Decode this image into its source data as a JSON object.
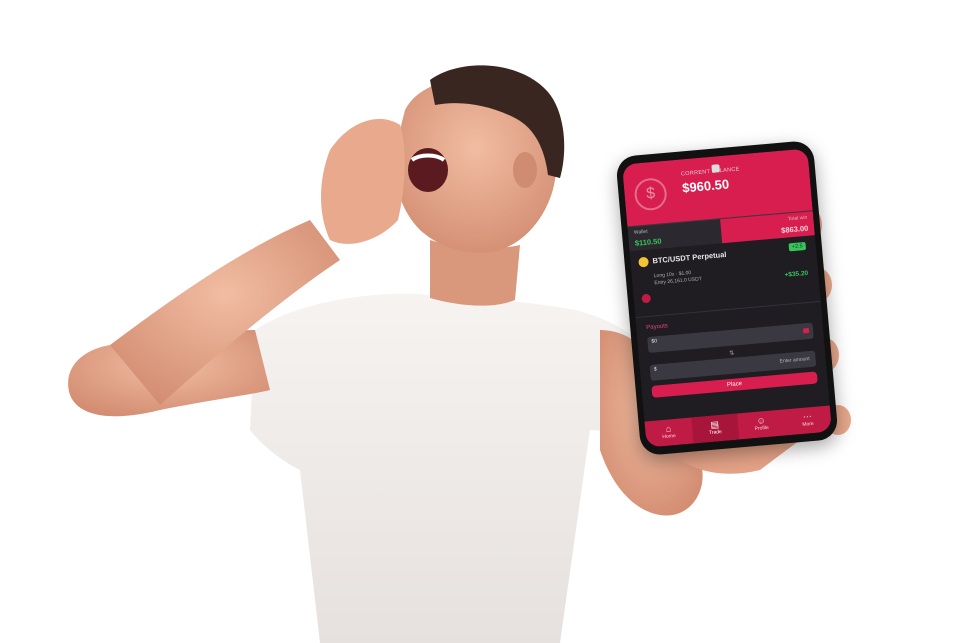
{
  "app": {
    "balance_caption": "CORRENT BALANCE",
    "balance": "$960.50",
    "stats": {
      "left_label": "Wallet",
      "left_value": "$110.50",
      "right_label": "Total win",
      "right_value": "$863.00"
    },
    "asset": {
      "name": "BTC/USDT Perpetual",
      "badge": "+2.5",
      "line1": "Long 10x · $1.00",
      "line2": "Entry 26,161.0 USDT",
      "pnl": "+$35.20"
    },
    "payouts": {
      "title": "Payouts",
      "field1": "$0",
      "swap": "⇅",
      "field2": "$",
      "field2_hint": "Enter amount",
      "button": "Place"
    },
    "tabs": [
      {
        "label": "Home",
        "icon": "home-icon"
      },
      {
        "label": "Trade",
        "icon": "trade-icon"
      },
      {
        "label": "Profile",
        "icon": "profile-icon"
      },
      {
        "label": "More",
        "icon": "more-icon"
      }
    ]
  },
  "colors": {
    "brand": "#d81e4f",
    "profit": "#36c45b",
    "screen_bg": "#1f1d22",
    "shirt": "#f2efee",
    "skin": "#e7a98c",
    "hair": "#3a2620"
  }
}
